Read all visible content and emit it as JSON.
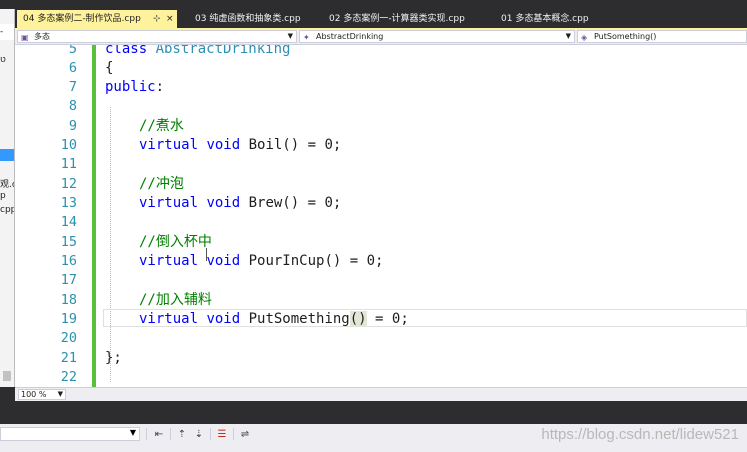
{
  "tabs": [
    {
      "label": "04 多态案例二-制作饮品.cpp",
      "active": true,
      "pin": "⊹",
      "close": "×"
    },
    {
      "label": "03 纯虚函数和抽象类.cpp",
      "active": false
    },
    {
      "label": "02 多态案例一-计算器类实现.cpp",
      "active": false
    },
    {
      "label": "01 多态基本概念.cpp",
      "active": false
    }
  ],
  "navigation": {
    "project": "多态",
    "scope": "AbstractDrinking",
    "member": "PutSomething()"
  },
  "left_panel": {
    "fragments": [
      "-",
      "ט",
      "观.c",
      "p",
      "cpp"
    ]
  },
  "code": {
    "line_numbers": [
      "5",
      "6",
      "7",
      "8",
      "9",
      "10",
      "11",
      "12",
      "13",
      "14",
      "15",
      "16",
      "17",
      "18",
      "19",
      "20",
      "21",
      "22"
    ],
    "lines": [
      {
        "kw": "class ",
        "cls": "AbstractDrinking"
      },
      {
        "text": "{"
      },
      {
        "kw": "public",
        "text": ":"
      },
      {
        "text": ""
      },
      {
        "cm": "//煮水"
      },
      {
        "kw1": "virtual ",
        "kw2": "void ",
        "text": "Boil() = 0;"
      },
      {
        "text": ""
      },
      {
        "cm": "//冲泡"
      },
      {
        "kw1": "virtual ",
        "kw2": "void ",
        "text": "Brew() = 0;"
      },
      {
        "text": ""
      },
      {
        "cm": "//倒入杯中"
      },
      {
        "kw1": "virtual ",
        "kw2": "void ",
        "text": "PourInCup() = 0;"
      },
      {
        "text": ""
      },
      {
        "cm": "//加入辅料"
      },
      {
        "kw1": "virtual ",
        "kw2": "void ",
        "name": "PutSomething",
        "paren": "()",
        "text": " = 0;"
      },
      {
        "text": ""
      },
      {
        "text": "};"
      },
      {
        "text": ""
      }
    ]
  },
  "status": {
    "zoom": "100 %"
  },
  "watermark": "https://blog.csdn.net/lidew521",
  "colors": {
    "keyword": "#0000ff",
    "class_name": "#2b91af",
    "comment": "#008000",
    "active_tab": "#fff29d",
    "change_bar": "#5cbf3b"
  }
}
